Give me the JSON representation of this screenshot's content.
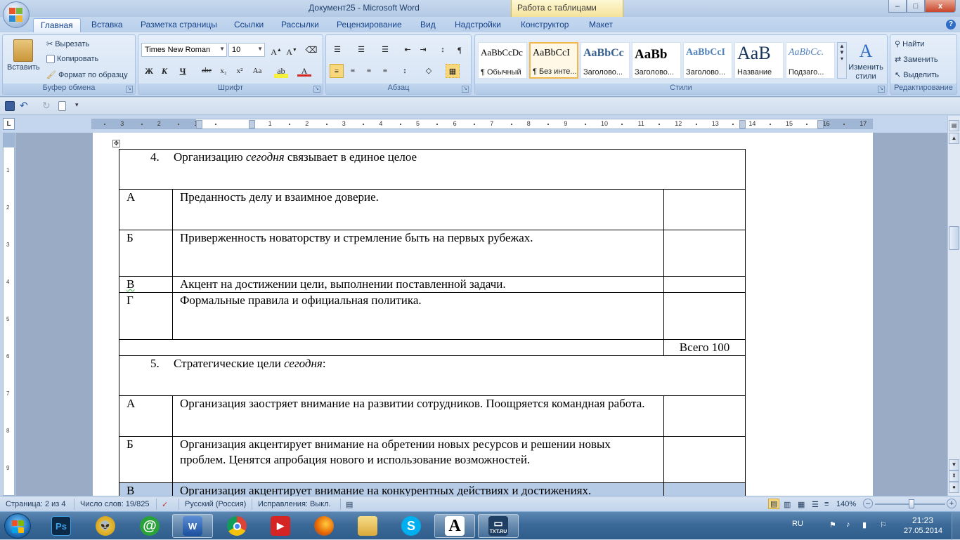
{
  "window": {
    "title": "Документ25 - Microsoft Word",
    "context_tab": "Работа с таблицами",
    "minimize": "–",
    "maximize": "□",
    "close": "x"
  },
  "tabs": [
    {
      "label": "Главная",
      "active": true
    },
    {
      "label": "Вставка"
    },
    {
      "label": "Разметка страницы"
    },
    {
      "label": "Ссылки"
    },
    {
      "label": "Рассылки"
    },
    {
      "label": "Рецензирование"
    },
    {
      "label": "Вид"
    },
    {
      "label": "Надстройки"
    },
    {
      "label": "Конструктор"
    },
    {
      "label": "Макет"
    }
  ],
  "ribbon": {
    "clipboard": {
      "label": "Буфер обмена",
      "paste": "Вставить",
      "cut": "Вырезать",
      "copy": "Копировать",
      "format_painter": "Формат по образцу"
    },
    "font": {
      "label": "Шрифт",
      "font_name": "Times New Roman",
      "font_size": "10"
    },
    "paragraph": {
      "label": "Абзац"
    },
    "styles": {
      "label": "Стили",
      "items": [
        {
          "sample": "AaBbCcDc",
          "name": "¶ Обычный"
        },
        {
          "sample": "AaBbCcI",
          "name": "¶ Без инте...",
          "selected": true
        },
        {
          "sample": "AaBbCc",
          "name": "Заголово..."
        },
        {
          "sample": "AaBb",
          "name": "Заголово..."
        },
        {
          "sample": "AaBbCcI",
          "name": "Заголово..."
        },
        {
          "sample": "AaB",
          "name": "Название"
        },
        {
          "sample": "AaBbCc.",
          "name": "Подзаго..."
        }
      ],
      "change_styles": "Изменить стили"
    },
    "editing": {
      "label": "Редактирование",
      "find": "Найти",
      "replace": "Заменить",
      "select": "Выделить"
    }
  },
  "ruler": {
    "corner": "L",
    "labels": [
      "3",
      "2",
      "1",
      "1",
      "2",
      "3",
      "4",
      "5",
      "6",
      "7",
      "8",
      "9",
      "10",
      "11",
      "12",
      "13",
      "14",
      "15",
      "16",
      "17"
    ]
  },
  "document": {
    "q4": {
      "num": "4.",
      "pre": "Организацию ",
      "em": "сегодня",
      "post": " связывает в единое целое"
    },
    "q4_rows": [
      {
        "letter": "А",
        "text": "Преданность делу и взаимное доверие."
      },
      {
        "letter": "Б",
        "text": "Приверженность новаторству и стремление быть на первых рубежах."
      },
      {
        "letter": "В",
        "text": "Акцент на достижении цели, выполнении поставленной задачи."
      },
      {
        "letter": "Г",
        "text": "Формальные правила и официальная политика."
      }
    ],
    "total": "Всего 100",
    "q5": {
      "num": "5.",
      "pre": "Стратегические цели ",
      "em": "сегодня",
      "post": ":"
    },
    "q5_rows": [
      {
        "letter": "А",
        "text": "Организация заостряет внимание на развитии сотрудников. Поощряется командная работа."
      },
      {
        "letter": "Б",
        "text": "Организация акцентирует  внимание на обретении новых ресурсов и решении новых проблем. Ценятся апробация нового и использование возможностей."
      },
      {
        "letter": "В",
        "text": "Организация акцентирует  внимание на конкурентных действиях и достижениях."
      }
    ]
  },
  "status": {
    "page": "Страница: 2 из 4",
    "words": "Число слов: 19/825",
    "language": "Русский (Россия)",
    "track_changes": "Исправления: Выкл.",
    "zoom": "140%",
    "zoom_minus": "–",
    "zoom_plus": "+"
  },
  "taskbar": {
    "lang": "RU",
    "time": "21:23",
    "date": "27.05.2014",
    "apps": [
      "photoshop",
      "mail-agent",
      "mail-ru",
      "word",
      "chrome",
      "video",
      "firefox",
      "explorer",
      "skype",
      "font-app",
      "txt-ru"
    ],
    "txt_label": "TXT.RU",
    "ps_label": "Ps",
    "font_label": "A"
  }
}
